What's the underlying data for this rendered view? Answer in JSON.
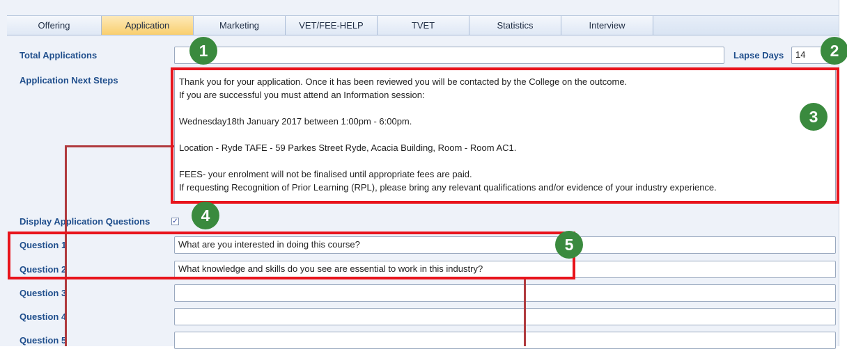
{
  "tabs": [
    {
      "label": "Offering"
    },
    {
      "label": "Application"
    },
    {
      "label": "Marketing"
    },
    {
      "label": "VET/FEE-HELP"
    },
    {
      "label": "TVET"
    },
    {
      "label": "Statistics"
    },
    {
      "label": "Interview"
    }
  ],
  "active_tab": "Application",
  "form": {
    "total_applications_label": "Total Applications",
    "total_applications_value": "",
    "lapse_days_label": "Lapse Days",
    "lapse_days_value": "14",
    "next_steps_label": "Application Next Steps",
    "next_steps_lines": [
      "Thank you for your application. Once it has been reviewed you will be contacted by the College on the outcome.",
      "If you are successful you must attend an Information session:",
      "",
      "Wednesday18th January 2017 between 1:00pm - 6:00pm.",
      "",
      "Location - Ryde TAFE  - 59 Parkes Street Ryde, Acacia Building, Room - Room AC1.",
      "",
      "FEES- your enrolment will not be finalised until appropriate fees are paid.",
      "If requesting Recognition of Prior Learning (RPL), please bring any relevant qualifications and/or evidence of your industry experience."
    ],
    "display_questions_label": "Display Application Questions",
    "display_questions_checked": true,
    "questions": [
      {
        "label": "Question 1",
        "value": "What are you interested in doing this course?"
      },
      {
        "label": "Question 2",
        "value": "What knowledge and skills do you see are essential to work in this industry?"
      },
      {
        "label": "Question 3",
        "value": ""
      },
      {
        "label": "Question 4",
        "value": ""
      },
      {
        "label": "Question 5",
        "value": ""
      }
    ]
  },
  "callouts": [
    "1",
    "2",
    "3",
    "4",
    "5"
  ],
  "colors": {
    "accent_red": "#e8141c",
    "callout_green": "#3a8a3e",
    "active_tab": "#f9cf6e",
    "label_blue": "#1f4e8c"
  }
}
